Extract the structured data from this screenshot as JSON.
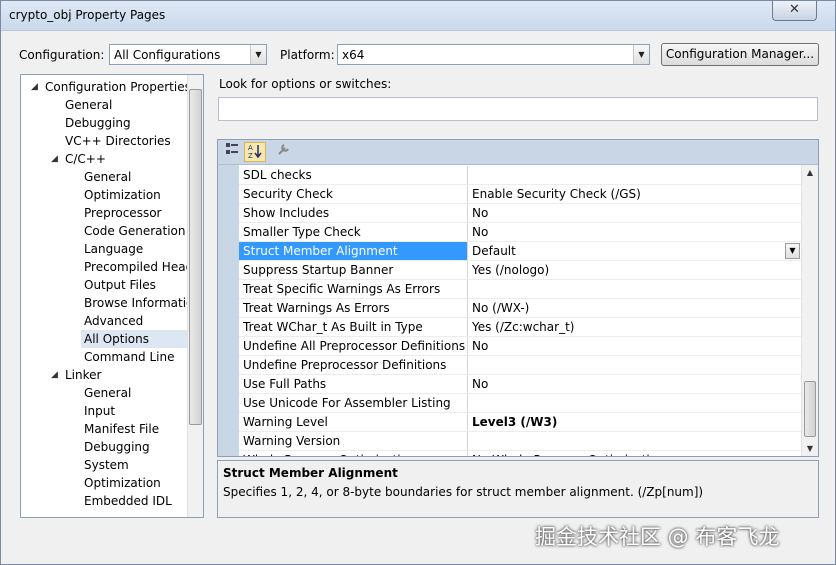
{
  "window": {
    "title": "crypto_obj Property Pages",
    "close_glyph": "✕"
  },
  "toolbar": {
    "configuration_label": "Configuration:",
    "configuration_value": "All Configurations",
    "platform_label": "Platform:",
    "platform_value": "x64",
    "config_manager_label": "Configuration Manager..."
  },
  "tree": {
    "items": [
      {
        "label": "Configuration Properties",
        "level": 0,
        "expanded": true
      },
      {
        "label": "General",
        "level": 1
      },
      {
        "label": "Debugging",
        "level": 1
      },
      {
        "label": "VC++ Directories",
        "level": 1
      },
      {
        "label": "C/C++",
        "level": 1,
        "expanded": true
      },
      {
        "label": "General",
        "level": 2
      },
      {
        "label": "Optimization",
        "level": 2
      },
      {
        "label": "Preprocessor",
        "level": 2
      },
      {
        "label": "Code Generation",
        "level": 2
      },
      {
        "label": "Language",
        "level": 2
      },
      {
        "label": "Precompiled Heade",
        "level": 2
      },
      {
        "label": "Output Files",
        "level": 2
      },
      {
        "label": "Browse Information",
        "level": 2
      },
      {
        "label": "Advanced",
        "level": 2
      },
      {
        "label": "All Options",
        "level": 2,
        "selected": true
      },
      {
        "label": "Command Line",
        "level": 2
      },
      {
        "label": "Linker",
        "level": 1,
        "expanded": true
      },
      {
        "label": "General",
        "level": 2
      },
      {
        "label": "Input",
        "level": 2
      },
      {
        "label": "Manifest File",
        "level": 2
      },
      {
        "label": "Debugging",
        "level": 2
      },
      {
        "label": "System",
        "level": 2
      },
      {
        "label": "Optimization",
        "level": 2
      },
      {
        "label": "Embedded IDL",
        "level": 2
      }
    ]
  },
  "search": {
    "label": "Look for options or switches:",
    "value": ""
  },
  "grid": {
    "toolbar_icons": [
      "categorized-icon",
      "alphabetical-icon",
      "property-pages-icon"
    ],
    "rows": [
      {
        "name": "SDL checks",
        "value": ""
      },
      {
        "name": "Security Check",
        "value": "Enable Security Check (/GS)"
      },
      {
        "name": "Show Includes",
        "value": "No"
      },
      {
        "name": "Smaller Type Check",
        "value": "No"
      },
      {
        "name": "Struct Member Alignment",
        "value": "Default",
        "selected": true
      },
      {
        "name": "Suppress Startup Banner",
        "value": "Yes (/nologo)"
      },
      {
        "name": "Treat Specific Warnings As Errors",
        "value": ""
      },
      {
        "name": "Treat Warnings As Errors",
        "value": "No (/WX-)"
      },
      {
        "name": "Treat WChar_t As Built in Type",
        "value": "Yes (/Zc:wchar_t)"
      },
      {
        "name": "Undefine All Preprocessor Definitions",
        "value": "No"
      },
      {
        "name": "Undefine Preprocessor Definitions",
        "value": ""
      },
      {
        "name": "Use Full Paths",
        "value": "No"
      },
      {
        "name": "Use Unicode For Assembler Listing",
        "value": ""
      },
      {
        "name": "Warning Level",
        "value": "Level3 (/W3)",
        "bold": true
      },
      {
        "name": "Warning Version",
        "value": ""
      },
      {
        "name": "Whole Program Optimization",
        "value": "No Whole Program Optimization"
      }
    ]
  },
  "description": {
    "title": "Struct Member Alignment",
    "text": "Specifies 1, 2, 4, or 8-byte boundaries for struct member alignment.     (/Zp[num])"
  },
  "watermark": "掘金技术社区 @ 布客飞龙"
}
